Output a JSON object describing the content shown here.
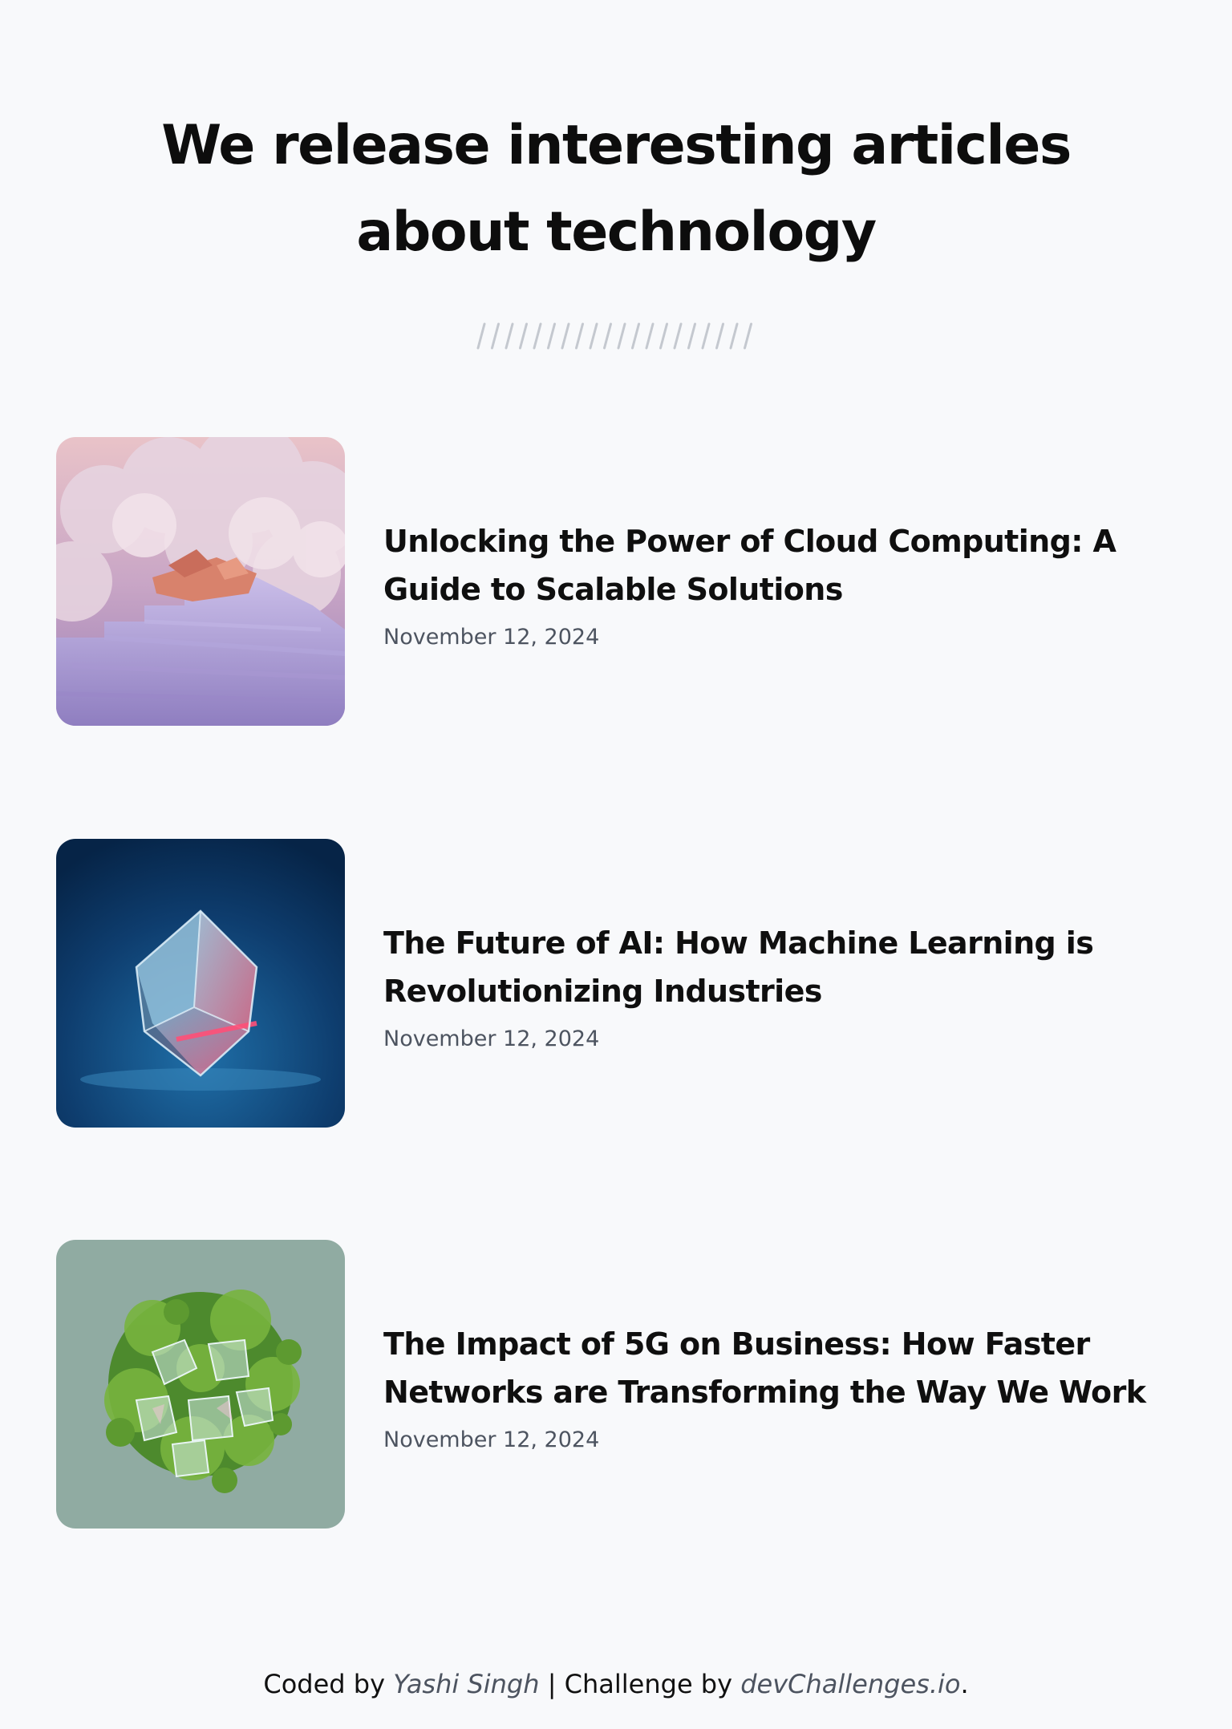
{
  "header": {
    "title_line1": "We release interesting articles",
    "title_line2": "about technology"
  },
  "articles": [
    {
      "title": "Unlocking the Power of Cloud Computing: A Guide to Scalable Solutions",
      "date": "November 12, 2024",
      "image": "clouds-staircase-image"
    },
    {
      "title": "The Future of AI: How Machine Learning is Revolutionizing Industries",
      "date": "November 12, 2024",
      "image": "glass-cube-image"
    },
    {
      "title": "The Impact of 5G on Business: How Faster Networks are Transforming the Way We Work",
      "date": "November 12, 2024",
      "image": "green-crystal-cluster-image"
    }
  ],
  "footer": {
    "coded_by_prefix": "Coded by",
    "author": "Yashi Singh",
    "separator": "| Challenge by",
    "site": "devChallenges.io",
    "period": "."
  },
  "colors": {
    "background": "#f8f9fb",
    "text": "#0f0f0f",
    "muted": "#4d5460",
    "divider": "#c4c8cf"
  }
}
